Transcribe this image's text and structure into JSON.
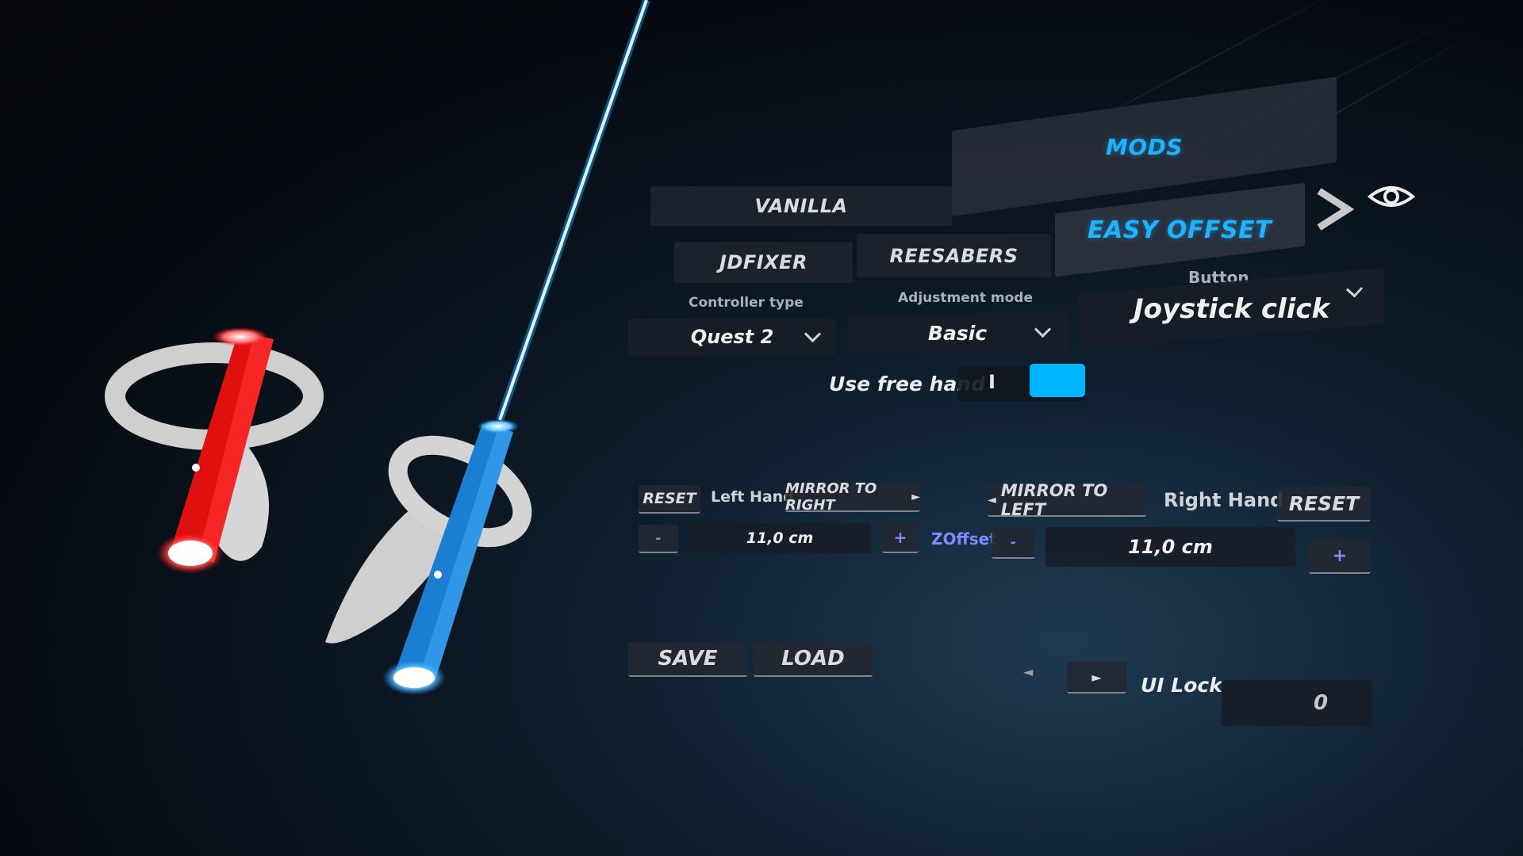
{
  "tabs": {
    "top": [
      {
        "label": "VANILLA",
        "active": false
      },
      {
        "label": "MODS",
        "active": true
      }
    ],
    "sub": [
      {
        "label": "JDFIXER",
        "active": false
      },
      {
        "label": "REESABERS",
        "active": false
      },
      {
        "label": "EASY OFFSET",
        "active": true
      }
    ]
  },
  "settings": {
    "controller_type": {
      "label": "Controller type",
      "value": "Quest 2"
    },
    "adjustment_mode": {
      "label": "Adjustment mode",
      "value": "Basic"
    },
    "button": {
      "label": "Button",
      "value": "Joystick click"
    },
    "free_hand": {
      "label": "Use free hand",
      "toggle_text": "I",
      "on": true
    }
  },
  "left_hand": {
    "reset": "RESET",
    "title": "Left Hand",
    "mirror": "MIRROR TO RIGHT",
    "minus": "-",
    "value": "11,0 cm",
    "plus": "+"
  },
  "axis_label": "ZOffset",
  "right_hand": {
    "mirror": "MIRROR TO LEFT",
    "title": "Right Hand",
    "reset": "RESET",
    "minus": "-",
    "value": "11,0 cm",
    "plus": "+"
  },
  "bottom": {
    "save": "SAVE",
    "load": "LOAD",
    "ui_lock_label": "UI Lock",
    "ui_lock_value": "0"
  },
  "colors": {
    "accent": "#1fb3ff",
    "toggle_on": "#00b4ff",
    "left_saber": "#ff1a1a",
    "right_saber": "#1a8fff",
    "plus": "#7b8cff"
  },
  "icons": [
    "next-arrow-icon",
    "eye-icon",
    "chevron-down-icon",
    "arrow-left-icon",
    "arrow-right-icon"
  ]
}
